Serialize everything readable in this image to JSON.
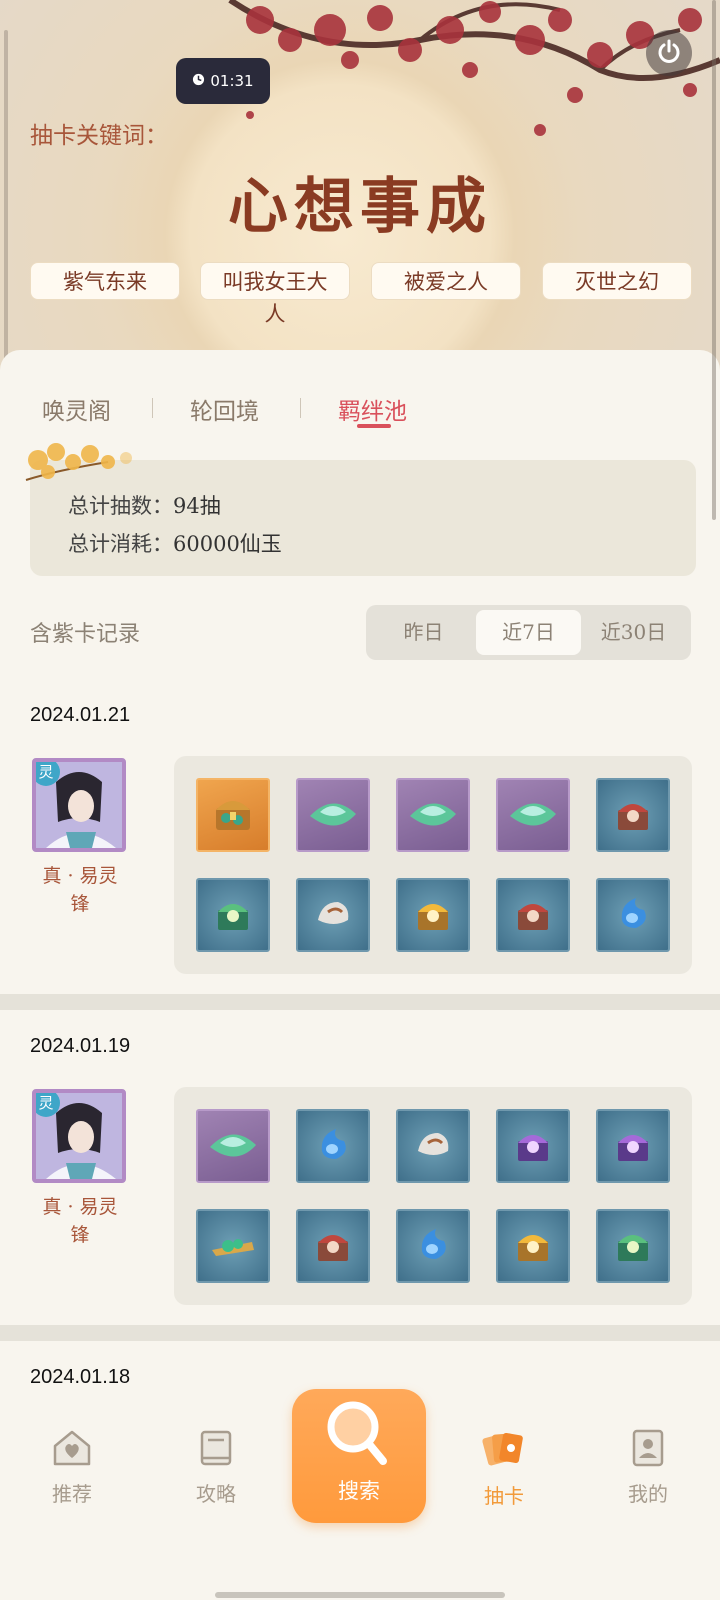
{
  "header": {
    "timer": "01:31",
    "keyword_label": "抽卡关键词：",
    "keyword_main": "心想事成",
    "keyword_chips": [
      "紫气东来",
      "叫我女王大",
      "被爱之人",
      "灭世之幻"
    ],
    "keyword_chip_overflow": "人"
  },
  "tabs": {
    "items": [
      "唤灵阁",
      "轮回境",
      "羁绊池"
    ],
    "active_index": 2
  },
  "summary": {
    "total_pulls_label": "总计抽数：",
    "total_pulls_value": "94抽",
    "total_cost_label": "总计消耗：",
    "total_cost_value": "60000仙玉"
  },
  "records": {
    "title": "含紫卡记录",
    "ranges": [
      "昨日",
      "近7日",
      "近30日"
    ],
    "active_range": 1,
    "groups": [
      {
        "date": "2024.01.21",
        "character_badge": "灵",
        "character_name_line1": "真 · 易灵",
        "character_name_line2": "锋",
        "items": [
          {
            "type": "treasure-chest",
            "rarity": "orange"
          },
          {
            "type": "jade-leaf",
            "rarity": "purple"
          },
          {
            "type": "jade-leaf",
            "rarity": "purple"
          },
          {
            "type": "jade-leaf",
            "rarity": "purple"
          },
          {
            "type": "red-box",
            "rarity": "blue"
          },
          {
            "type": "green-box",
            "rarity": "blue"
          },
          {
            "type": "stone",
            "rarity": "blue"
          },
          {
            "type": "gold-box",
            "rarity": "blue"
          },
          {
            "type": "red-box",
            "rarity": "blue"
          },
          {
            "type": "blue-flame",
            "rarity": "blue"
          }
        ]
      },
      {
        "date": "2024.01.19",
        "character_badge": "灵",
        "character_name_line1": "真 · 易灵",
        "character_name_line2": "锋",
        "items": [
          {
            "type": "jade-leaf",
            "rarity": "purple"
          },
          {
            "type": "blue-flame",
            "rarity": "blue"
          },
          {
            "type": "stone",
            "rarity": "blue"
          },
          {
            "type": "purple-box",
            "rarity": "blue"
          },
          {
            "type": "purple-box",
            "rarity": "blue"
          },
          {
            "type": "green-scroll",
            "rarity": "blue"
          },
          {
            "type": "red-box",
            "rarity": "blue"
          },
          {
            "type": "blue-flame",
            "rarity": "blue"
          },
          {
            "type": "gold-box",
            "rarity": "blue"
          },
          {
            "type": "green-box",
            "rarity": "blue"
          }
        ]
      },
      {
        "date": "2024.01.18"
      }
    ]
  },
  "bottom_nav": {
    "items": [
      "推荐",
      "攻略",
      "搜索",
      "抽卡",
      "我的"
    ],
    "active_index": 3
  },
  "colors": {
    "accent": "#d9505b",
    "orange": "#ff9a3c",
    "title_red": "#8a3b22"
  }
}
